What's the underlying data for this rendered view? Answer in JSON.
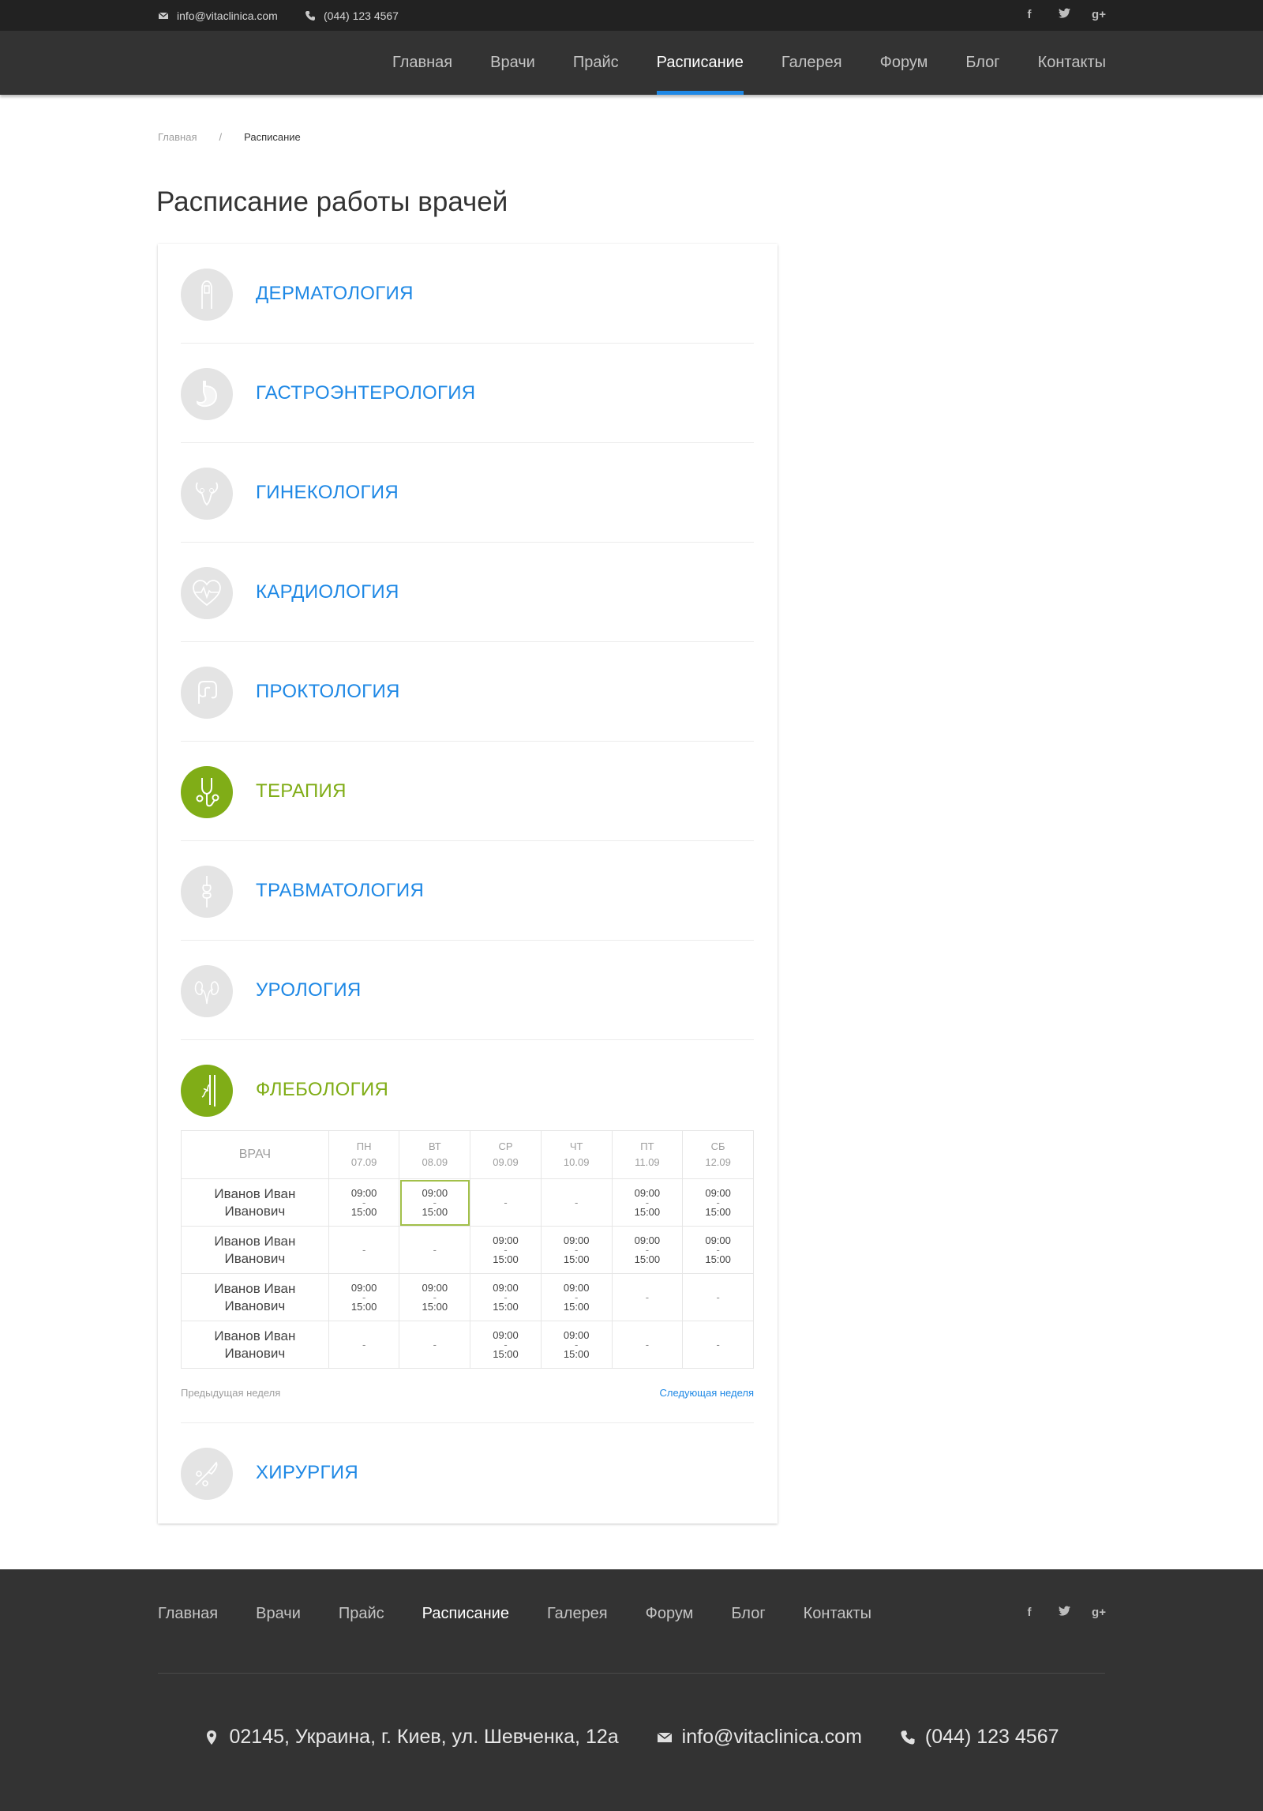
{
  "topbar": {
    "email": "info@vitaclinica.com",
    "phone": "(044) 123 4567",
    "social": {
      "facebook": "f",
      "twitter": "t",
      "google": "g+"
    }
  },
  "nav": {
    "items": [
      {
        "label": "Главная"
      },
      {
        "label": "Врачи"
      },
      {
        "label": "Прайс"
      },
      {
        "label": "Расписание",
        "active": true
      },
      {
        "label": "Галерея"
      },
      {
        "label": "Форум"
      },
      {
        "label": "Блог"
      },
      {
        "label": "Контакты"
      }
    ]
  },
  "breadcrumb": {
    "home": "Главная",
    "separator": "/",
    "current": "Расписание"
  },
  "page_title": "Расписание работы врачей",
  "departments": [
    {
      "name": "ДЕРМАТОЛОГИЯ",
      "icon": "finger-icon",
      "active": false
    },
    {
      "name": "ГАСТРОЭНТЕРОЛОГИЯ",
      "icon": "stomach-icon",
      "active": false
    },
    {
      "name": "ГИНЕКОЛОГИЯ",
      "icon": "uterus-icon",
      "active": false
    },
    {
      "name": "КАРДИОЛОГИЯ",
      "icon": "heart-pulse-icon",
      "active": false
    },
    {
      "name": "ПРОКТОЛОГИЯ",
      "icon": "intestine-icon",
      "active": false
    },
    {
      "name": "ТЕРАПИЯ",
      "icon": "stethoscope-icon",
      "active": true
    },
    {
      "name": "ТРАВМАТОЛОГИЯ",
      "icon": "bone-joint-icon",
      "active": false
    },
    {
      "name": "УРОЛОГИЯ",
      "icon": "kidney-icon",
      "active": false
    },
    {
      "name": "ФЛЕБОЛОГИЯ",
      "icon": "leg-vein-icon",
      "active": true
    },
    {
      "name": "ХИРУРГИЯ",
      "icon": "scalpel-icon",
      "active": false
    }
  ],
  "schedule": {
    "doctor_header": "ВРАЧ",
    "days": [
      {
        "day": "ПН",
        "date": "07.09"
      },
      {
        "day": "ВТ",
        "date": "08.09"
      },
      {
        "day": "СР",
        "date": "09.09"
      },
      {
        "day": "ЧТ",
        "date": "10.09"
      },
      {
        "day": "ПТ",
        "date": "11.09"
      },
      {
        "day": "СБ",
        "date": "12.09"
      }
    ],
    "rows": [
      {
        "doctor_line1": "Иванов Иван",
        "doctor_line2": "Иванович",
        "cells": [
          [
            "09:00",
            "-",
            "15:00"
          ],
          [
            "09:00",
            "-",
            "15:00"
          ],
          [
            "-"
          ],
          [
            "-"
          ],
          [
            "09:00",
            "-",
            "15:00"
          ],
          [
            "09:00",
            "-",
            "15:00"
          ]
        ]
      },
      {
        "doctor_line1": "Иванов Иван",
        "doctor_line2": "Иванович",
        "cells": [
          [
            "-"
          ],
          [
            "-"
          ],
          [
            "09:00",
            "-",
            "15:00"
          ],
          [
            "09:00",
            "-",
            "15:00"
          ],
          [
            "09:00",
            "-",
            "15:00"
          ],
          [
            "09:00",
            "-",
            "15:00"
          ]
        ]
      },
      {
        "doctor_line1": "Иванов Иван",
        "doctor_line2": "Иванович",
        "cells": [
          [
            "09:00",
            "-",
            "15:00"
          ],
          [
            "09:00",
            "-",
            "15:00"
          ],
          [
            "09:00",
            "-",
            "15:00"
          ],
          [
            "09:00",
            "-",
            "15:00"
          ],
          [
            "-"
          ],
          [
            "-"
          ]
        ]
      },
      {
        "doctor_line1": "Иванов Иван",
        "doctor_line2": "Иванович",
        "cells": [
          [
            "-"
          ],
          [
            "-"
          ],
          [
            "09:00",
            "-",
            "15:00"
          ],
          [
            "09:00",
            "-",
            "15:00"
          ],
          [
            "-"
          ],
          [
            "-"
          ]
        ]
      }
    ],
    "selected_cell": {
      "row": 0,
      "col": 1
    },
    "prev_week": "Предыдущая неделя",
    "next_week": "Следующая неделя"
  },
  "footer": {
    "nav": [
      "Главная",
      "Врачи",
      "Прайс",
      "Расписание",
      "Галерея",
      "Форум",
      "Блог",
      "Контакты"
    ],
    "active": "Расписание",
    "address": "02145, Украина, г. Киев, ул. Шевченка, 12а",
    "email": "info@vitaclinica.com",
    "phone": "(044) 123 4567"
  },
  "colors": {
    "accent_blue": "#1e88e5",
    "accent_green": "#80ad17",
    "dark": "#333333",
    "topbar": "#222222"
  }
}
